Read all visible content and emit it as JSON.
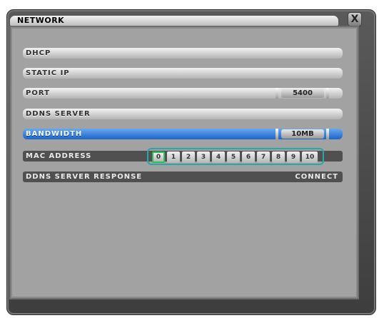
{
  "window": {
    "title": "NETWORK",
    "close_label": "X"
  },
  "rows": [
    {
      "label": "DHCP"
    },
    {
      "label": "STATIC IP"
    },
    {
      "label": "PORT",
      "value": "5400"
    },
    {
      "label": "DDNS SERVER"
    },
    {
      "label": "BANDWIDTH",
      "value": "10MB"
    },
    {
      "label": "MAC ADDRESS"
    },
    {
      "label": "DDNS SERVER RESPONSE",
      "value": "CONNECT"
    }
  ],
  "mac_buttons": [
    "0",
    "1",
    "2",
    "3",
    "4",
    "5",
    "6",
    "7",
    "8",
    "9",
    "10"
  ],
  "mac_selected": "0",
  "colors": {
    "selected_row": "#1d64c8",
    "mac_border": "#2aa6a6",
    "mac_selected_border": "#2fbf5a"
  }
}
